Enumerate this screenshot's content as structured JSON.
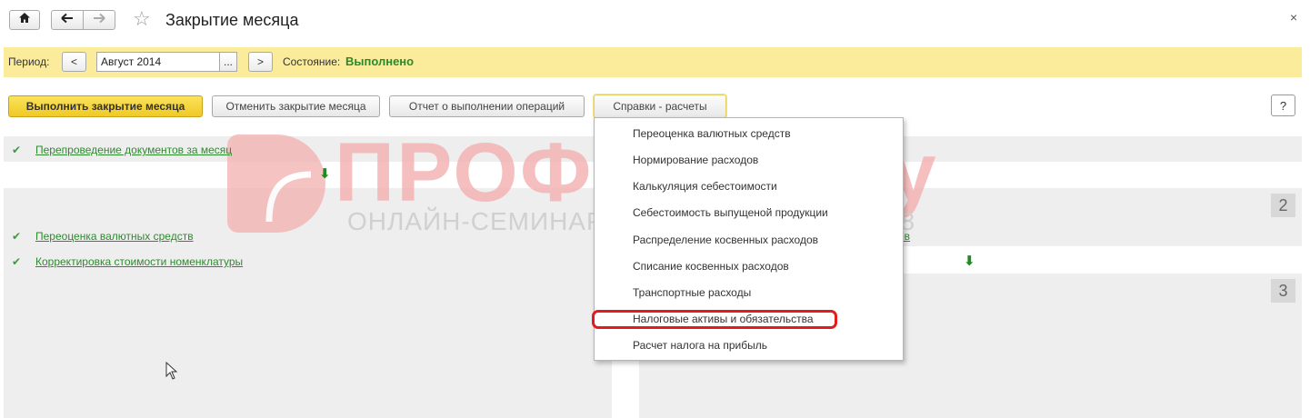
{
  "window": {
    "title": "Закрытие месяца",
    "close_glyph": "×"
  },
  "nav": {
    "home_icon": "home-icon",
    "back_icon": "back-arrow-icon",
    "forward_icon": "forward-arrow-icon",
    "favorite_icon": "star-icon"
  },
  "period_bar": {
    "period_label": "Период:",
    "prev_label": "<",
    "next_label": ">",
    "period_value": "Август 2014",
    "picker_label": "...",
    "status_label": "Состояние:",
    "status_value": "Выполнено"
  },
  "toolbar": {
    "run_close": "Выполнить закрытие месяца",
    "cancel_close": "Отменить закрытие месяца",
    "report": "Отчет о выполнении операций",
    "references": "Справки - расчеты",
    "help": "?"
  },
  "stages": {
    "step1": {
      "operation": "Перепроведение документов за месяц"
    },
    "step2": {
      "number": "2",
      "operations": [
        "Переоценка валютных средств",
        "Корректировка стоимости номенклатуры"
      ],
      "partial_right": "ов"
    },
    "step3": {
      "number": "3"
    }
  },
  "references_menu": {
    "items": [
      "Переоценка валютных средств",
      "Нормирование расходов",
      "Калькуляция себестоимости",
      "Себестоимость выпущеной продукции",
      "Распределение косвенных расходов",
      "Списание косвенных расходов",
      "Транспортные расходы",
      "Налоговые активы и обязательства",
      "Расчет налога на прибыль"
    ],
    "highlighted_index": 7
  },
  "watermark": {
    "title": "ПРОФБУХ8.ру",
    "subtitle": "ОНЛАЙН-СЕМИНАРЫ И ВИДЕОКУРСЫ 1С:8"
  },
  "colors": {
    "accent_yellow": "#fbec9c",
    "primary_button": "#f0c925",
    "link_green": "#2f8a2f",
    "highlight_red": "#e21b1b"
  }
}
